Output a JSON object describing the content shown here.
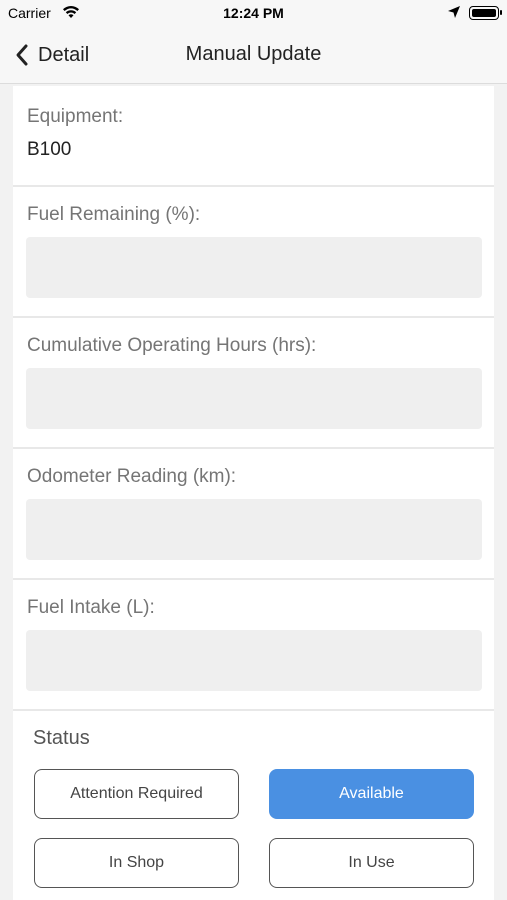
{
  "status_bar": {
    "carrier": "Carrier",
    "time": "12:24 PM",
    "icons": [
      "wifi-icon",
      "location-arrow-icon",
      "battery-icon"
    ]
  },
  "nav": {
    "back_label": "Detail",
    "title": "Manual Update"
  },
  "equipment": {
    "label": "Equipment:",
    "value": "B100"
  },
  "fields": [
    {
      "label": "Fuel Remaining (%):",
      "value": ""
    },
    {
      "label": "Cumulative Operating Hours (hrs):",
      "value": ""
    },
    {
      "label": "Odometer Reading (km):",
      "value": ""
    },
    {
      "label": "Fuel Intake (L):",
      "value": ""
    }
  ],
  "status": {
    "label": "Status",
    "options": [
      "Attention Required",
      "Available",
      "In Shop",
      "In Use"
    ],
    "selected": "Available"
  },
  "colors": {
    "accent": "#4a90e2",
    "input_bg": "#efefef",
    "label": "#757575"
  }
}
